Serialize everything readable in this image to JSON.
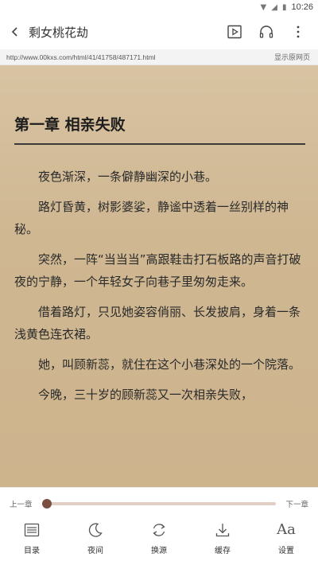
{
  "status": {
    "time": "10:26"
  },
  "header": {
    "title": "剩女桃花劫"
  },
  "url_bar": {
    "url": "http://www.00kxs.com/html/41/41758/487171.html",
    "show_original": "显示原网页"
  },
  "chapter": {
    "title": "第一章 相亲失败",
    "paragraphs": [
      "夜色渐深，一条僻静幽深的小巷。",
      "路灯昏黄，树影婆娑，静谧中透着一丝别样的神秘。",
      "突然，一阵“当当当”高跟鞋击打石板路的声音打破夜的宁静，一个年轻女子向巷子里匆匆走来。",
      "借着路灯，只见她姿容俏丽、长发披肩，身着一条浅黄色连衣裙。",
      "她，叫顾新蕊，就住在这个小巷深处的一个院落。",
      "今晚，三十岁的顾新蕊又一次相亲失败，"
    ]
  },
  "progress": {
    "prev": "上一章",
    "next": "下一章",
    "fraction": 0.0
  },
  "nav": {
    "contents": "目录",
    "night": "夜间",
    "source": "换源",
    "cache": "缓存",
    "settings": "设置",
    "settings_glyph": "Aa"
  },
  "colors": {
    "accent": "#7a4f42",
    "paper": "#cfb792"
  }
}
